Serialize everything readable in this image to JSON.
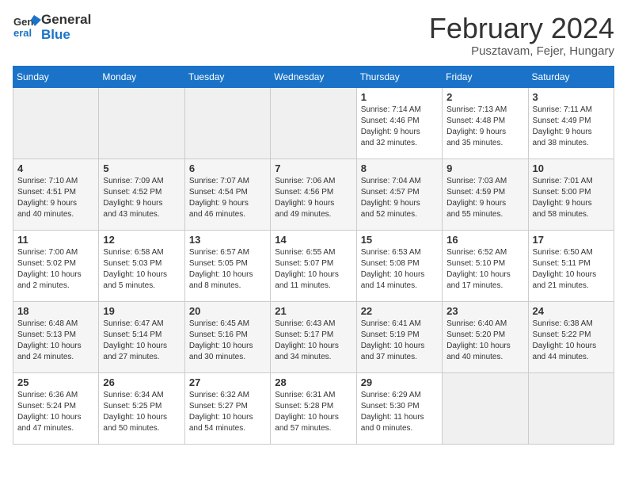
{
  "logo": {
    "line1": "General",
    "line2": "Blue"
  },
  "title": "February 2024",
  "location": "Pusztavam, Fejer, Hungary",
  "days_of_week": [
    "Sunday",
    "Monday",
    "Tuesday",
    "Wednesday",
    "Thursday",
    "Friday",
    "Saturday"
  ],
  "weeks": [
    [
      {
        "num": "",
        "info": ""
      },
      {
        "num": "",
        "info": ""
      },
      {
        "num": "",
        "info": ""
      },
      {
        "num": "",
        "info": ""
      },
      {
        "num": "1",
        "info": "Sunrise: 7:14 AM\nSunset: 4:46 PM\nDaylight: 9 hours\nand 32 minutes."
      },
      {
        "num": "2",
        "info": "Sunrise: 7:13 AM\nSunset: 4:48 PM\nDaylight: 9 hours\nand 35 minutes."
      },
      {
        "num": "3",
        "info": "Sunrise: 7:11 AM\nSunset: 4:49 PM\nDaylight: 9 hours\nand 38 minutes."
      }
    ],
    [
      {
        "num": "4",
        "info": "Sunrise: 7:10 AM\nSunset: 4:51 PM\nDaylight: 9 hours\nand 40 minutes."
      },
      {
        "num": "5",
        "info": "Sunrise: 7:09 AM\nSunset: 4:52 PM\nDaylight: 9 hours\nand 43 minutes."
      },
      {
        "num": "6",
        "info": "Sunrise: 7:07 AM\nSunset: 4:54 PM\nDaylight: 9 hours\nand 46 minutes."
      },
      {
        "num": "7",
        "info": "Sunrise: 7:06 AM\nSunset: 4:56 PM\nDaylight: 9 hours\nand 49 minutes."
      },
      {
        "num": "8",
        "info": "Sunrise: 7:04 AM\nSunset: 4:57 PM\nDaylight: 9 hours\nand 52 minutes."
      },
      {
        "num": "9",
        "info": "Sunrise: 7:03 AM\nSunset: 4:59 PM\nDaylight: 9 hours\nand 55 minutes."
      },
      {
        "num": "10",
        "info": "Sunrise: 7:01 AM\nSunset: 5:00 PM\nDaylight: 9 hours\nand 58 minutes."
      }
    ],
    [
      {
        "num": "11",
        "info": "Sunrise: 7:00 AM\nSunset: 5:02 PM\nDaylight: 10 hours\nand 2 minutes."
      },
      {
        "num": "12",
        "info": "Sunrise: 6:58 AM\nSunset: 5:03 PM\nDaylight: 10 hours\nand 5 minutes."
      },
      {
        "num": "13",
        "info": "Sunrise: 6:57 AM\nSunset: 5:05 PM\nDaylight: 10 hours\nand 8 minutes."
      },
      {
        "num": "14",
        "info": "Sunrise: 6:55 AM\nSunset: 5:07 PM\nDaylight: 10 hours\nand 11 minutes."
      },
      {
        "num": "15",
        "info": "Sunrise: 6:53 AM\nSunset: 5:08 PM\nDaylight: 10 hours\nand 14 minutes."
      },
      {
        "num": "16",
        "info": "Sunrise: 6:52 AM\nSunset: 5:10 PM\nDaylight: 10 hours\nand 17 minutes."
      },
      {
        "num": "17",
        "info": "Sunrise: 6:50 AM\nSunset: 5:11 PM\nDaylight: 10 hours\nand 21 minutes."
      }
    ],
    [
      {
        "num": "18",
        "info": "Sunrise: 6:48 AM\nSunset: 5:13 PM\nDaylight: 10 hours\nand 24 minutes."
      },
      {
        "num": "19",
        "info": "Sunrise: 6:47 AM\nSunset: 5:14 PM\nDaylight: 10 hours\nand 27 minutes."
      },
      {
        "num": "20",
        "info": "Sunrise: 6:45 AM\nSunset: 5:16 PM\nDaylight: 10 hours\nand 30 minutes."
      },
      {
        "num": "21",
        "info": "Sunrise: 6:43 AM\nSunset: 5:17 PM\nDaylight: 10 hours\nand 34 minutes."
      },
      {
        "num": "22",
        "info": "Sunrise: 6:41 AM\nSunset: 5:19 PM\nDaylight: 10 hours\nand 37 minutes."
      },
      {
        "num": "23",
        "info": "Sunrise: 6:40 AM\nSunset: 5:20 PM\nDaylight: 10 hours\nand 40 minutes."
      },
      {
        "num": "24",
        "info": "Sunrise: 6:38 AM\nSunset: 5:22 PM\nDaylight: 10 hours\nand 44 minutes."
      }
    ],
    [
      {
        "num": "25",
        "info": "Sunrise: 6:36 AM\nSunset: 5:24 PM\nDaylight: 10 hours\nand 47 minutes."
      },
      {
        "num": "26",
        "info": "Sunrise: 6:34 AM\nSunset: 5:25 PM\nDaylight: 10 hours\nand 50 minutes."
      },
      {
        "num": "27",
        "info": "Sunrise: 6:32 AM\nSunset: 5:27 PM\nDaylight: 10 hours\nand 54 minutes."
      },
      {
        "num": "28",
        "info": "Sunrise: 6:31 AM\nSunset: 5:28 PM\nDaylight: 10 hours\nand 57 minutes."
      },
      {
        "num": "29",
        "info": "Sunrise: 6:29 AM\nSunset: 5:30 PM\nDaylight: 11 hours\nand 0 minutes."
      },
      {
        "num": "",
        "info": ""
      },
      {
        "num": "",
        "info": ""
      }
    ]
  ]
}
